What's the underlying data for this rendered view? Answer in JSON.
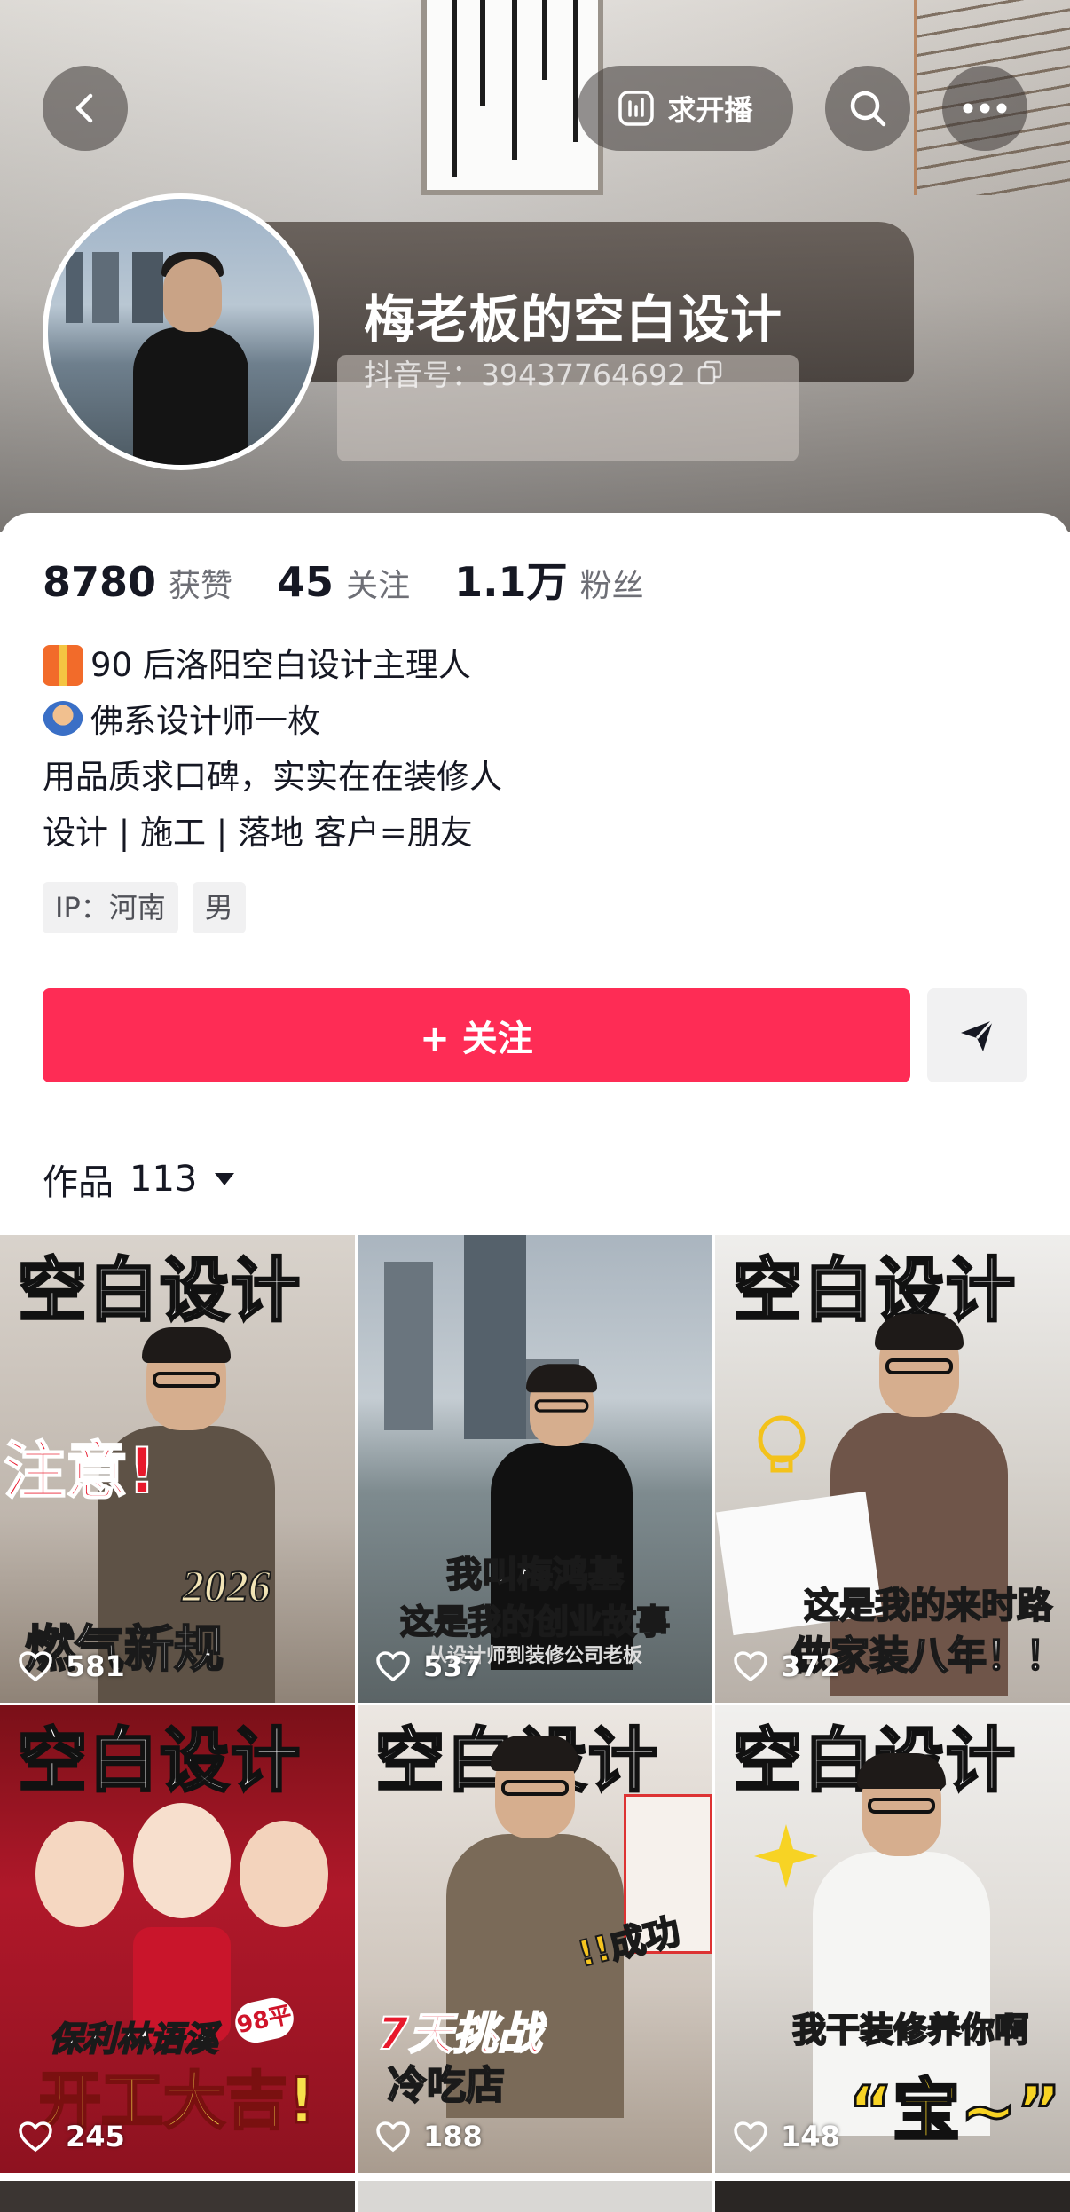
{
  "nav": {
    "back_icon": "chevron-left-icon",
    "live_request_label": "求开播",
    "live_request_icon": "bar-chart-icon",
    "search_icon": "search-icon",
    "more_icon": "ellipsis-icon"
  },
  "profile": {
    "name": "梅老板的空白设计",
    "douyin_id": "抖音号：39437764692",
    "copy_icon": "copy-icon"
  },
  "stats": {
    "likes_num": "8780",
    "likes_label": "获赞",
    "following_num": "45",
    "following_label": "关注",
    "followers_num": "1.1万",
    "followers_label": "粉丝"
  },
  "bio": {
    "line1": "90 后洛阳空白设计主理人",
    "line2": "佛系设计师一枚",
    "line3": "用品质求口碑，实实在在装修人",
    "line4": "设计 | 施工 | 落地 客户=朋友"
  },
  "tags": {
    "ip": "IP：河南",
    "gender": "男"
  },
  "actions": {
    "follow_label": "+ 关注",
    "share_icon": "send-icon"
  },
  "works": {
    "label": "作品",
    "count": "113",
    "dropdown_icon": "triangle-down-icon"
  },
  "videos": [
    {
      "headline": "空白设计",
      "caption_a": "注意!",
      "caption_b": "2026",
      "caption_c": "燃气新规",
      "likes": "581"
    },
    {
      "headline": "",
      "caption_a": "我叫梅鸿基",
      "caption_b": "这是我的创业故事",
      "caption_c": "从设计师到装修公司老板",
      "likes": "537"
    },
    {
      "headline": "空白设计",
      "caption_a": "这是我的来时路",
      "caption_b": "做家装八年！！",
      "caption_c": "",
      "likes": "372"
    },
    {
      "headline": "空白设计",
      "caption_a": "保利林语溪",
      "caption_b": "开工大吉!",
      "caption_c": "98平",
      "likes": "245"
    },
    {
      "headline": "空白设计",
      "caption_a": "!!成功",
      "caption_b": "7天挑战",
      "caption_c": "冷吃店",
      "likes": "188"
    },
    {
      "headline": "空白设计",
      "caption_a": "我干装修养你啊",
      "caption_b": "“宝~”",
      "caption_c": "",
      "likes": "148"
    }
  ],
  "colors": {
    "accent": "#fe2c55",
    "text": "#161823",
    "muted": "#6e6f76",
    "tag_bg": "#f1f1f2"
  }
}
